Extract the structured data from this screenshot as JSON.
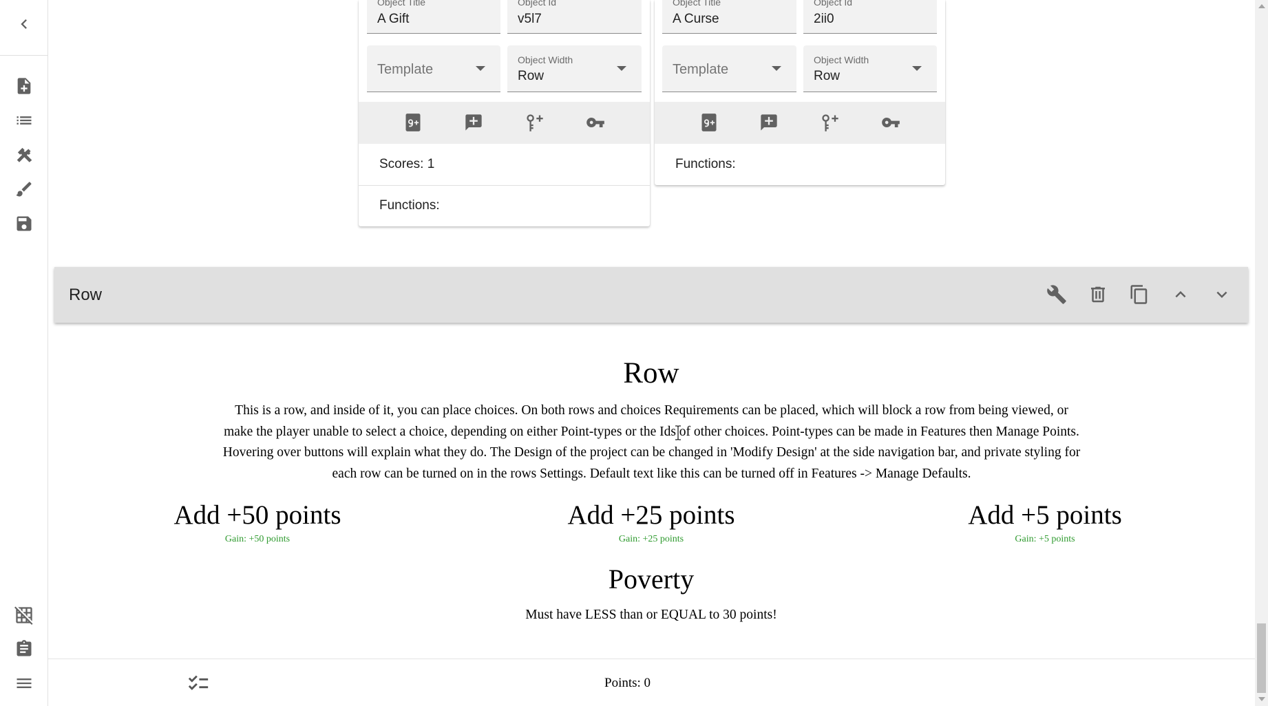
{
  "sidebar": {
    "items": [
      {
        "icon": "chevron-left-icon"
      },
      {
        "icon": "note-add-icon"
      },
      {
        "icon": "list-icon"
      },
      {
        "icon": "tools-icon"
      },
      {
        "icon": "brush-icon"
      },
      {
        "icon": "save-icon"
      },
      {
        "icon": "grid-off-icon"
      },
      {
        "icon": "clipboard-icon"
      },
      {
        "icon": "menu-icon"
      }
    ]
  },
  "objects": [
    {
      "title_label": "Object Title",
      "title_value": "A Gift",
      "id_label": "Object Id",
      "id_value": "v5l7",
      "template_placeholder": "Template",
      "width_label": "Object Width",
      "width_value": "Row",
      "scores": "Scores: 1",
      "functions": "Functions:"
    },
    {
      "title_label": "Object Title",
      "title_value": "A Curse",
      "id_label": "Object Id",
      "id_value": "2ii0",
      "template_placeholder": "Template",
      "width_label": "Object Width",
      "width_value": "Row",
      "functions": "Functions:"
    }
  ],
  "row_header": {
    "title": "Row"
  },
  "row": {
    "title": "Row",
    "text": "This is a row, and inside of it, you can place choices. On both rows and choices Requirements can be placed, which will block a row from being viewed, or make the player unable to select a choice, depending on either Point-types or the Ids of other choices. Point-types can be made in Features then Manage Points. Hovering over buttons will explain what they do. The Design of the project can be changed in 'Modify Design' at the side navigation bar, and private styling for each row can be turned on in the rows Settings. Default text like this can be turned off in Features -> Manage Defaults.",
    "choices": [
      {
        "title": "Add +50 points",
        "gain": "Gain: +50  points"
      },
      {
        "title": "Add +25 points",
        "gain": "Gain: +25  points"
      },
      {
        "title": "Add +5 points",
        "gain": "Gain: +5  points"
      }
    ]
  },
  "poverty": {
    "title": "Poverty",
    "text": "Must have LESS than or EQUAL to 30 points!"
  },
  "bottom_bar": {
    "points": "Points: 0"
  },
  "colors": {
    "gain": "#2e9a2e",
    "header_bg": "#e0e0e0",
    "toolbar_bg": "#eeeeee"
  }
}
